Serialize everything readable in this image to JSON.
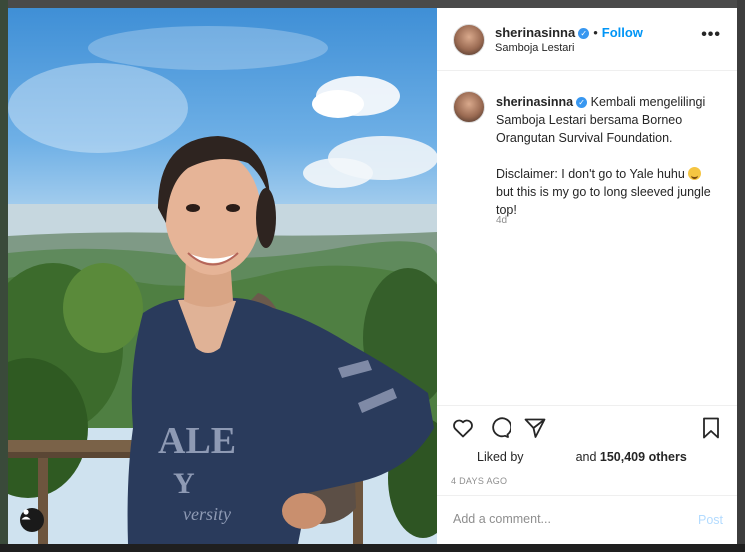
{
  "post": {
    "username": "sherinasinna",
    "follow_label": "Follow",
    "dot": "•",
    "location": "Samboja Lestari",
    "more_label": "•••",
    "caption_text": "Kembali mengelilingi Samboja Lestari bersama Borneo Orangutan Survival Foundation.",
    "disclaimer_text": "Disclaimer: I don't go to Yale huhu",
    "disclaimer_text_2": "but this is my go to long sleeved jungle top!",
    "caption_age": "4d",
    "liked_by_prefix": "Liked by",
    "liked_by_suffix": "and",
    "likes_count": "150,409 others",
    "posted_ago": "4 DAYS AGO",
    "comment_placeholder": "Add a comment...",
    "post_label": "Post"
  },
  "icons": {
    "verified": "verified-badge-icon",
    "like": "heart-icon",
    "comment": "comment-bubble-icon",
    "share": "paper-plane-icon",
    "save": "bookmark-icon",
    "tag": "user-tag-icon"
  },
  "colors": {
    "follow": "#0095f6",
    "verified": "#3897f0",
    "post_disabled": "#b3dbff",
    "muted": "#8e8e8e"
  },
  "photo": {
    "shirt_text_1": "ALE",
    "shirt_text_2": "Y",
    "shirt_text_3": "versity"
  }
}
